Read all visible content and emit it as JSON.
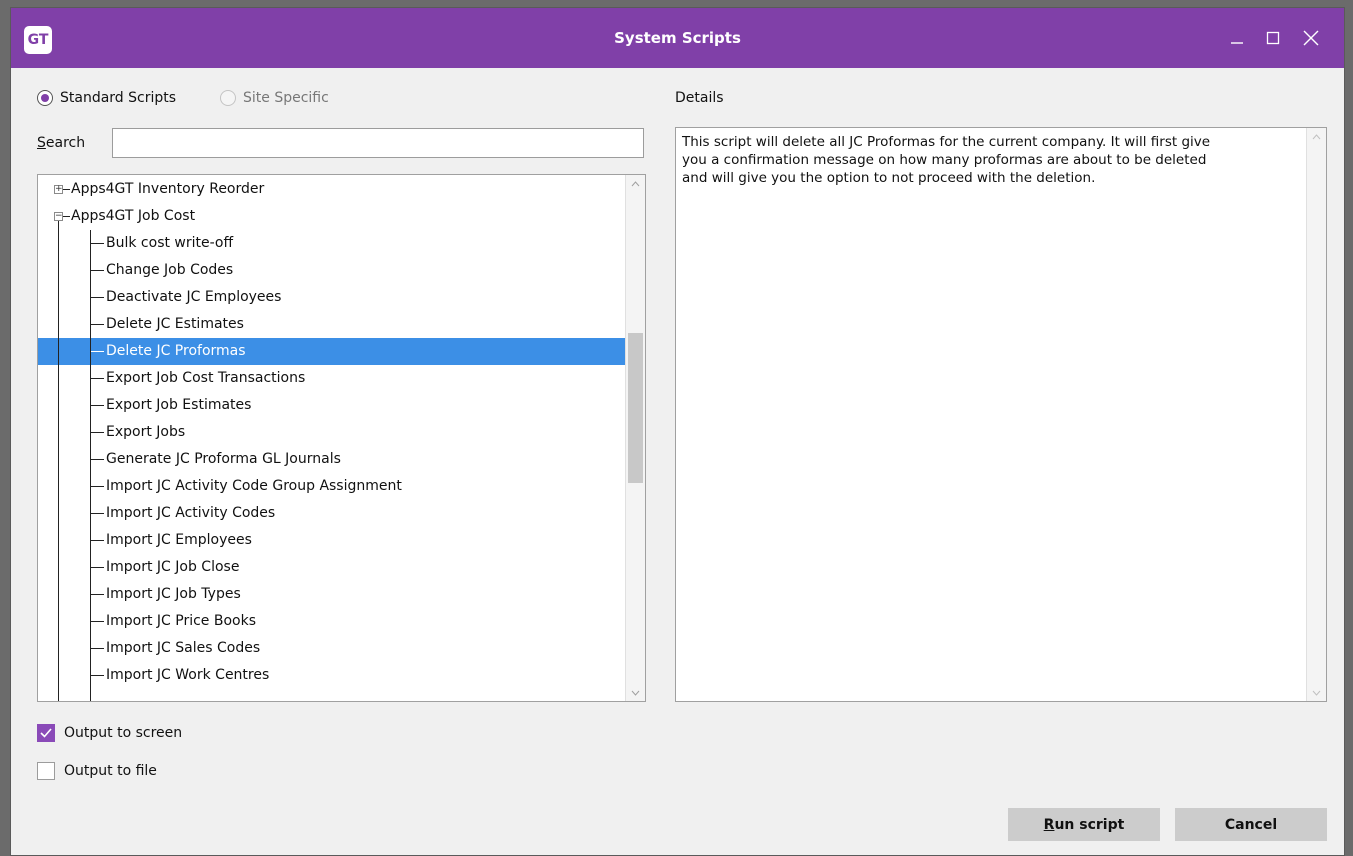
{
  "window": {
    "logo_text": "GT",
    "title": "System Scripts",
    "controls": [
      "minimize-icon",
      "maximize-icon",
      "close-icon"
    ]
  },
  "script_type": {
    "options": [
      "Standard Scripts",
      "Site Specific"
    ],
    "selected": "Standard Scripts"
  },
  "search": {
    "label": "Search",
    "value": ""
  },
  "tree": {
    "groups": [
      {
        "label": "Apps4GT Inventory Reorder",
        "expanded": false
      },
      {
        "label": "Apps4GT Job Cost",
        "expanded": true
      }
    ],
    "items": [
      "Bulk cost write-off",
      "Change Job Codes",
      "Deactivate JC Employees",
      "Delete JC Estimates",
      "Delete JC Proformas",
      "Export Job Cost Transactions",
      "Export Job Estimates",
      "Export Jobs",
      "Generate JC Proforma GL Journals",
      "Import JC Activity Code Group Assignment",
      "Import JC Activity Codes",
      "Import JC Employees",
      "Import JC Job Close",
      "Import JC Job Types",
      "Import JC Price Books",
      "Import JC Sales Codes",
      "Import JC Work Centres"
    ],
    "selected": "Delete JC Proformas"
  },
  "details": {
    "label": "Details",
    "text": "This script will delete all JC Proformas for the current company. It will first give\nyou a confirmation message on how many proformas are about to be deleted\nand will give you the option to not proceed with the deletion."
  },
  "output": {
    "screen_label": "Output to screen",
    "screen_checked": true,
    "file_label": "Output to file",
    "file_checked": false
  },
  "buttons": {
    "run": "Run script",
    "cancel": "Cancel"
  },
  "colors": {
    "accent": "#8040a8",
    "selection": "#3c8fe6"
  }
}
